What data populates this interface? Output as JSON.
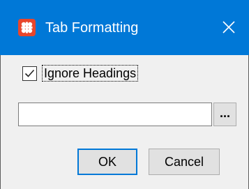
{
  "window": {
    "title": "Tab Formatting",
    "icon": "app-logo-icon",
    "close_icon": "close-icon"
  },
  "options": {
    "ignore_headings": {
      "label": "Ignore Headings",
      "checked": true
    }
  },
  "path_field": {
    "value": "",
    "placeholder": ""
  },
  "browse_button": {
    "label": "..."
  },
  "buttons": {
    "ok_label": "OK",
    "cancel_label": "Cancel"
  },
  "colors": {
    "title_bar": "#0078d7",
    "app_icon": "#e8462c",
    "dialog_background": "#f0f0f0",
    "default_button_border": "#0078d7"
  }
}
